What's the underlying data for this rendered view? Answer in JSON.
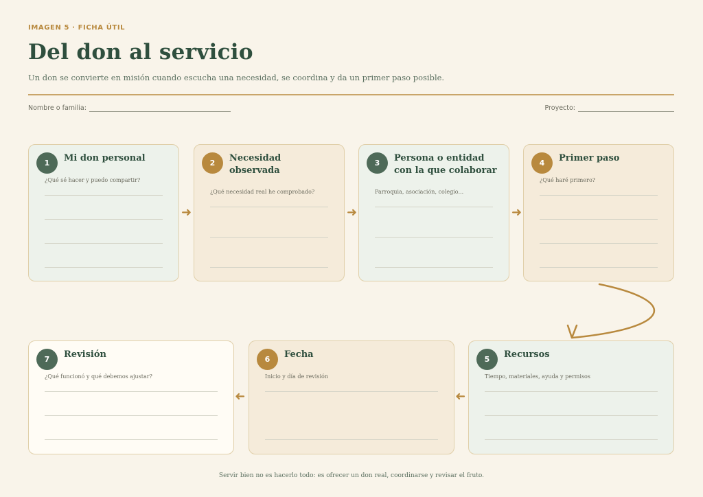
{
  "header": {
    "kicker": "IMAGEN 5 · FICHA ÚTIL",
    "title": "Del don al servicio",
    "subtitle": "Un don se convierte en misión cuando escucha una necesidad, se coordina y da un primer paso posible."
  },
  "fields": {
    "name_label": "Nombre o familia:",
    "project_label": "Proyecto:"
  },
  "steps": [
    {
      "number": "1",
      "title_lines": [
        "Mi don personal"
      ],
      "prompt": "¿Qué sé hacer y puedo compartir?"
    },
    {
      "number": "2",
      "title_lines": [
        "Necesidad",
        "observada"
      ],
      "prompt": "¿Qué necesidad real he comprobado?"
    },
    {
      "number": "3",
      "title_lines": [
        "Persona o entidad",
        "con la que colaborar"
      ],
      "prompt": "Parroquia, asociación, colegio..."
    },
    {
      "number": "4",
      "title_lines": [
        "Primer paso"
      ],
      "prompt": "¿Qué haré primero?"
    },
    {
      "number": "5",
      "title_lines": [
        "Recursos"
      ],
      "prompt": "Tiempo, materiales, ayuda y permisos"
    },
    {
      "number": "6",
      "title_lines": [
        "Fecha"
      ],
      "prompt": "Inicio y día de revisión"
    },
    {
      "number": "7",
      "title_lines": [
        "Revisión"
      ],
      "prompt": "¿Qué funcionó y qué debemos ajustar?"
    }
  ],
  "footer": "Servir bien no es hacerlo todo: es ofrecer un don real, coordinarse y revisar el fruto.",
  "colors": {
    "green": "#4e6a58",
    "gold": "#b8893e",
    "background": "#f9f4ea"
  },
  "icons": {
    "arrow_right": "arrow-right-icon",
    "arrow_left": "arrow-left-icon"
  }
}
